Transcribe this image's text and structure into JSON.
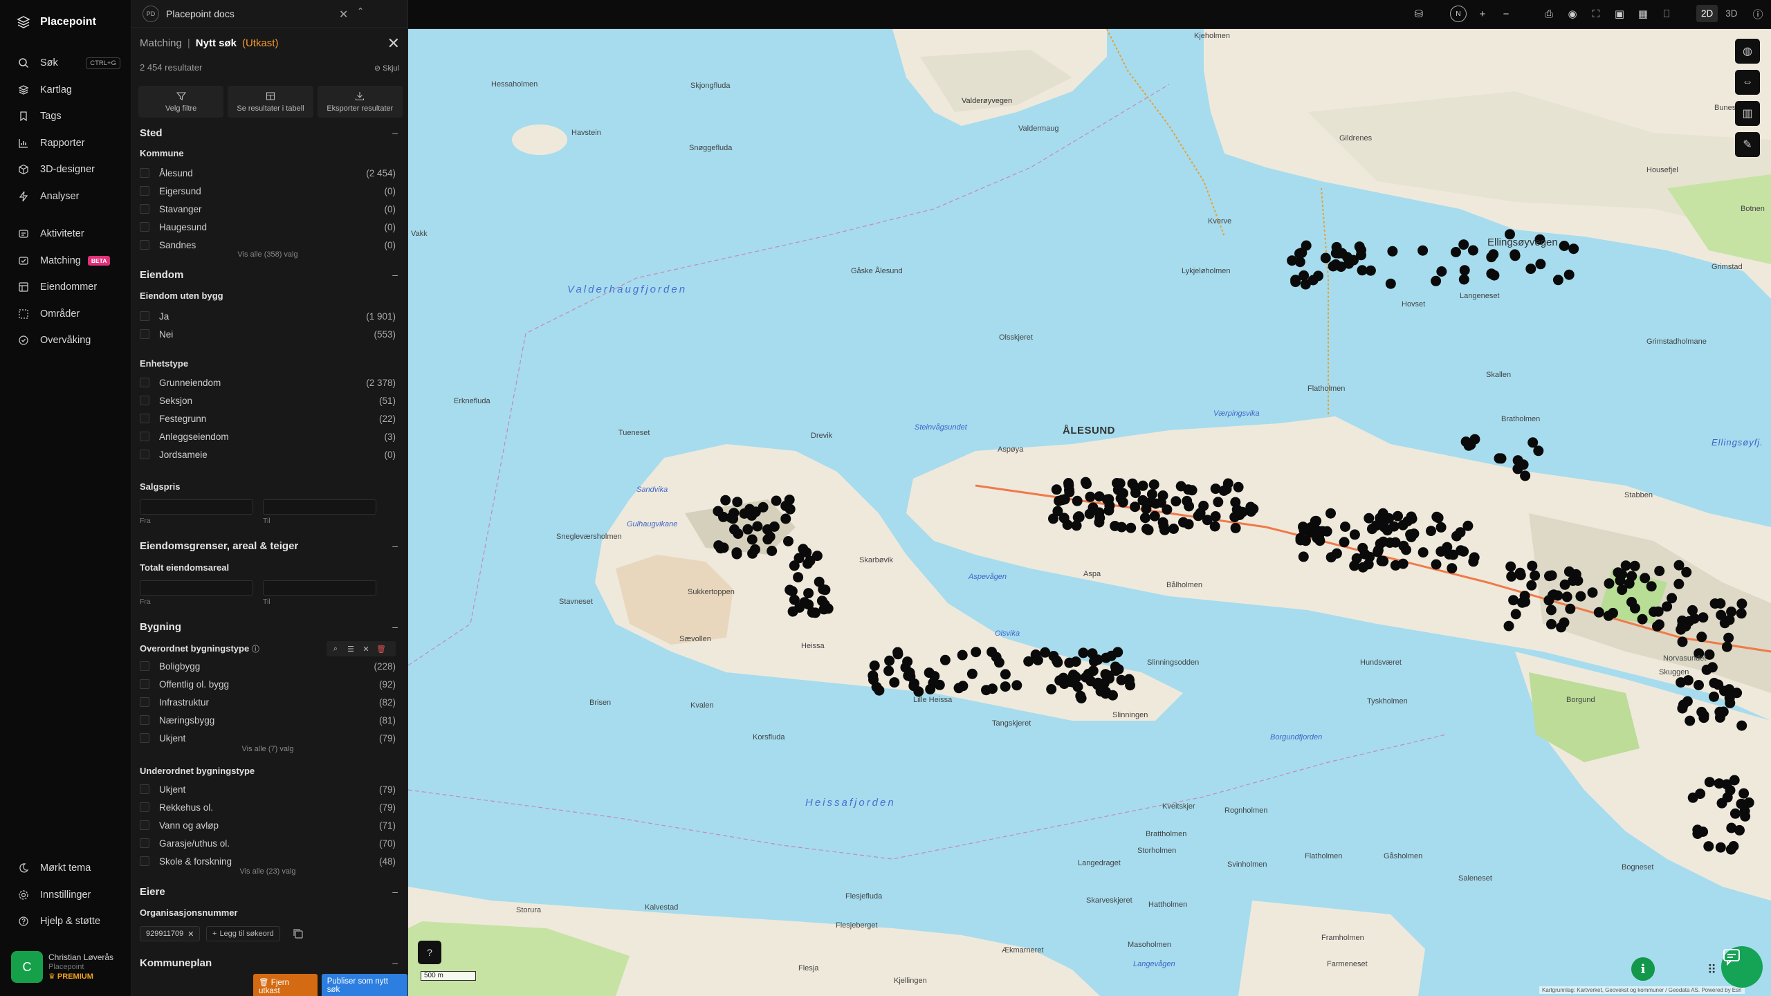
{
  "app": {
    "name": "Placepoint"
  },
  "nav": {
    "items": [
      {
        "label": "Søk",
        "shortcut": "CTRL+G",
        "icon": "search-icon"
      },
      {
        "label": "Kartlag",
        "icon": "layers-icon"
      },
      {
        "label": "Tags",
        "icon": "bookmark-icon"
      },
      {
        "label": "Rapporter",
        "icon": "chart-icon"
      },
      {
        "label": "3D-designer",
        "icon": "cube-icon"
      },
      {
        "label": "Analyser",
        "icon": "bolt-icon"
      }
    ],
    "items2": [
      {
        "label": "Aktiviteter",
        "icon": "activity-icon"
      },
      {
        "label": "Matching",
        "badge": "BETA",
        "icon": "match-icon"
      },
      {
        "label": "Eiendommer",
        "icon": "property-icon"
      },
      {
        "label": "Områder",
        "icon": "area-icon"
      },
      {
        "label": "Overvåking",
        "icon": "monitor-icon"
      }
    ],
    "bottom": [
      {
        "label": "Mørkt tema",
        "icon": "moon-icon"
      },
      {
        "label": "Innstillinger",
        "icon": "gear-icon"
      },
      {
        "label": "Hjelp & støtte",
        "icon": "help-icon"
      }
    ],
    "user": {
      "initial": "C",
      "name": "Christian Løverås",
      "org": "Placepoint",
      "plan": "PREMIUM"
    }
  },
  "tab": {
    "badge": "PD",
    "title": "Placepoint docs"
  },
  "panel": {
    "crumb": "Matching",
    "sep": "|",
    "title": "Nytt søk",
    "draft": "(Utkast)",
    "results": "2 454 resultater",
    "hide": "Skjul",
    "actions": [
      {
        "label": "Velg filtre",
        "icon": "filter-icon"
      },
      {
        "label": "Se resultater i tabell",
        "icon": "table-icon"
      },
      {
        "label": "Eksporter resultater",
        "icon": "download-icon"
      }
    ],
    "sted": {
      "title": "Sted",
      "kommune_title": "Kommune",
      "kommune": [
        {
          "label": "Ålesund",
          "count": "(2 454)"
        },
        {
          "label": "Eigersund",
          "count": "(0)"
        },
        {
          "label": "Stavanger",
          "count": "(0)"
        },
        {
          "label": "Haugesund",
          "count": "(0)"
        },
        {
          "label": "Sandnes",
          "count": "(0)"
        }
      ],
      "show_all": "Vis alle (358) valg"
    },
    "eiendom": {
      "title": "Eiendom",
      "uten_bygg_title": "Eiendom uten bygg",
      "uten_bygg": [
        {
          "label": "Ja",
          "count": "(1 901)"
        },
        {
          "label": "Nei",
          "count": "(553)"
        }
      ],
      "enhetstype_title": "Enhetstype",
      "enhetstype": [
        {
          "label": "Grunneiendom",
          "count": "(2 378)"
        },
        {
          "label": "Seksjon",
          "count": "(51)"
        },
        {
          "label": "Festegrunn",
          "count": "(22)"
        },
        {
          "label": "Anleggseiendom",
          "count": "(3)"
        },
        {
          "label": "Jordsameie",
          "count": "(0)"
        }
      ],
      "salgspris_title": "Salgspris",
      "from": "Fra",
      "to": "Til"
    },
    "grenser": {
      "title": "Eiendomsgrenser, areal & teiger",
      "areal_title": "Totalt eiendomsareal",
      "from": "Fra",
      "to": "Til"
    },
    "bygning": {
      "title": "Bygning",
      "overordnet_title": "Overordnet bygningstype",
      "overordnet": [
        {
          "label": "Boligbygg",
          "count": "(228)"
        },
        {
          "label": "Offentlig ol. bygg",
          "count": "(92)"
        },
        {
          "label": "Infrastruktur",
          "count": "(82)"
        },
        {
          "label": "Næringsbygg",
          "count": "(81)"
        },
        {
          "label": "Ukjent",
          "count": "(79)"
        }
      ],
      "overordnet_show_all": "Vis alle (7) valg",
      "underordnet_title": "Underordnet bygningstype",
      "underordnet": [
        {
          "label": "Ukjent",
          "count": "(79)"
        },
        {
          "label": "Rekkehus ol.",
          "count": "(79)"
        },
        {
          "label": "Vann og avløp",
          "count": "(71)"
        },
        {
          "label": "Garasje/uthus ol.",
          "count": "(70)"
        },
        {
          "label": "Skole & forskning",
          "count": "(48)"
        }
      ],
      "underordnet_show_all": "Vis alle (23) valg"
    },
    "eiere": {
      "title": "Eiere",
      "org_title": "Organisasjonsnummer",
      "chip": "929911709",
      "add_keyword": "Legg til søkeord"
    },
    "kommuneplan": {
      "title": "Kommuneplan"
    },
    "footer": {
      "remove": "Fjern utkast",
      "publish": "Publiser som nytt søk"
    }
  },
  "toolbar": {
    "north": "N",
    "view_2d": "2D",
    "view_3d": "3D",
    "icons": [
      "layers-stack-icon",
      "zoom-in-icon",
      "zoom-out-icon",
      "print-icon",
      "eye-icon",
      "fullscreen-icon",
      "camera-icon",
      "grid-icon",
      "bookmark-icon",
      "info-icon"
    ]
  },
  "map": {
    "scale": "500 m",
    "attribution": "Kartgrunnlag: Kartverket, Geovekst og kommuner / Geodata AS. Powered by Esri",
    "places": [
      {
        "name": "Hessaholmen"
      },
      {
        "name": "Skjongfluda"
      },
      {
        "name": "Havstein"
      },
      {
        "name": "Snøggefluda"
      },
      {
        "name": "Valderøyvegen"
      },
      {
        "name": "Valdermaug"
      },
      {
        "name": "Gildrenes"
      },
      {
        "name": "Kjeholmen"
      },
      {
        "name": "Valderhaugfjorden"
      },
      {
        "name": "Gåske Ålesund"
      },
      {
        "name": "Vakk"
      },
      {
        "name": "Kverve"
      },
      {
        "name": "Ellingsøyvegen"
      },
      {
        "name": "Hovset"
      },
      {
        "name": "Langeneset"
      },
      {
        "name": "Lykjeløholmen"
      },
      {
        "name": "Olsskjeret"
      },
      {
        "name": "Grimstadholmane"
      },
      {
        "name": "Skallen"
      },
      {
        "name": "Flatholmen"
      },
      {
        "name": "Bratholmen"
      },
      {
        "name": "ÅLESUND"
      },
      {
        "name": "Erknefluda"
      },
      {
        "name": "Tueneset"
      },
      {
        "name": "Drevik"
      },
      {
        "name": "Steinvågsundet"
      },
      {
        "name": "Aspøya"
      },
      {
        "name": "Værpingsvika"
      },
      {
        "name": "Ellingsøyfj."
      },
      {
        "name": "Stabben"
      },
      {
        "name": "Sandvika"
      },
      {
        "name": "Gulhaugvikane"
      },
      {
        "name": "Snegleværsholmen"
      },
      {
        "name": "Skarbøvik"
      },
      {
        "name": "Aspevågen"
      },
      {
        "name": "Aspa"
      },
      {
        "name": "Bålholmen"
      },
      {
        "name": "Stavneset"
      },
      {
        "name": "Sukkertoppen"
      },
      {
        "name": "Sævollen"
      },
      {
        "name": "Heissa"
      },
      {
        "name": "Olsvika"
      },
      {
        "name": "Slinningsodden"
      },
      {
        "name": "Hundsværet"
      },
      {
        "name": "Tyskholmen"
      },
      {
        "name": "Borgundfjorden"
      },
      {
        "name": "Brisen"
      },
      {
        "name": "Kvalen"
      },
      {
        "name": "Lille Heissa"
      },
      {
        "name": "Tangskjeret"
      },
      {
        "name": "Slinningen"
      },
      {
        "name": "Korsfluda"
      },
      {
        "name": "Heissafjorden"
      },
      {
        "name": "Kveitskjer"
      },
      {
        "name": "Rognholmen"
      },
      {
        "name": "Brattholmen"
      },
      {
        "name": "Storholmen"
      },
      {
        "name": "Svinholmen"
      },
      {
        "name": "Flatholmen"
      },
      {
        "name": "Gåsholmen"
      },
      {
        "name": "Saleneset"
      },
      {
        "name": "Bogneset"
      },
      {
        "name": "Langedraget"
      },
      {
        "name": "Skarveskjeret"
      },
      {
        "name": "Hattholmen"
      },
      {
        "name": "Flesjefluda"
      },
      {
        "name": "Flesjeberget"
      },
      {
        "name": "Kalvestad"
      },
      {
        "name": "Storura"
      },
      {
        "name": "Masoholmen"
      },
      {
        "name": "Langevågen"
      },
      {
        "name": "Framholmen"
      },
      {
        "name": "Farmeneset"
      },
      {
        "name": "Ækmarneret"
      },
      {
        "name": "Kjellingen"
      },
      {
        "name": "Flesja"
      },
      {
        "name": "Norvasundet"
      },
      {
        "name": "Skuggen"
      },
      {
        "name": "Borgund"
      },
      {
        "name": "Grimstad"
      },
      {
        "name": "Bunes"
      },
      {
        "name": "Botnen"
      },
      {
        "name": "Housefjel"
      }
    ]
  }
}
